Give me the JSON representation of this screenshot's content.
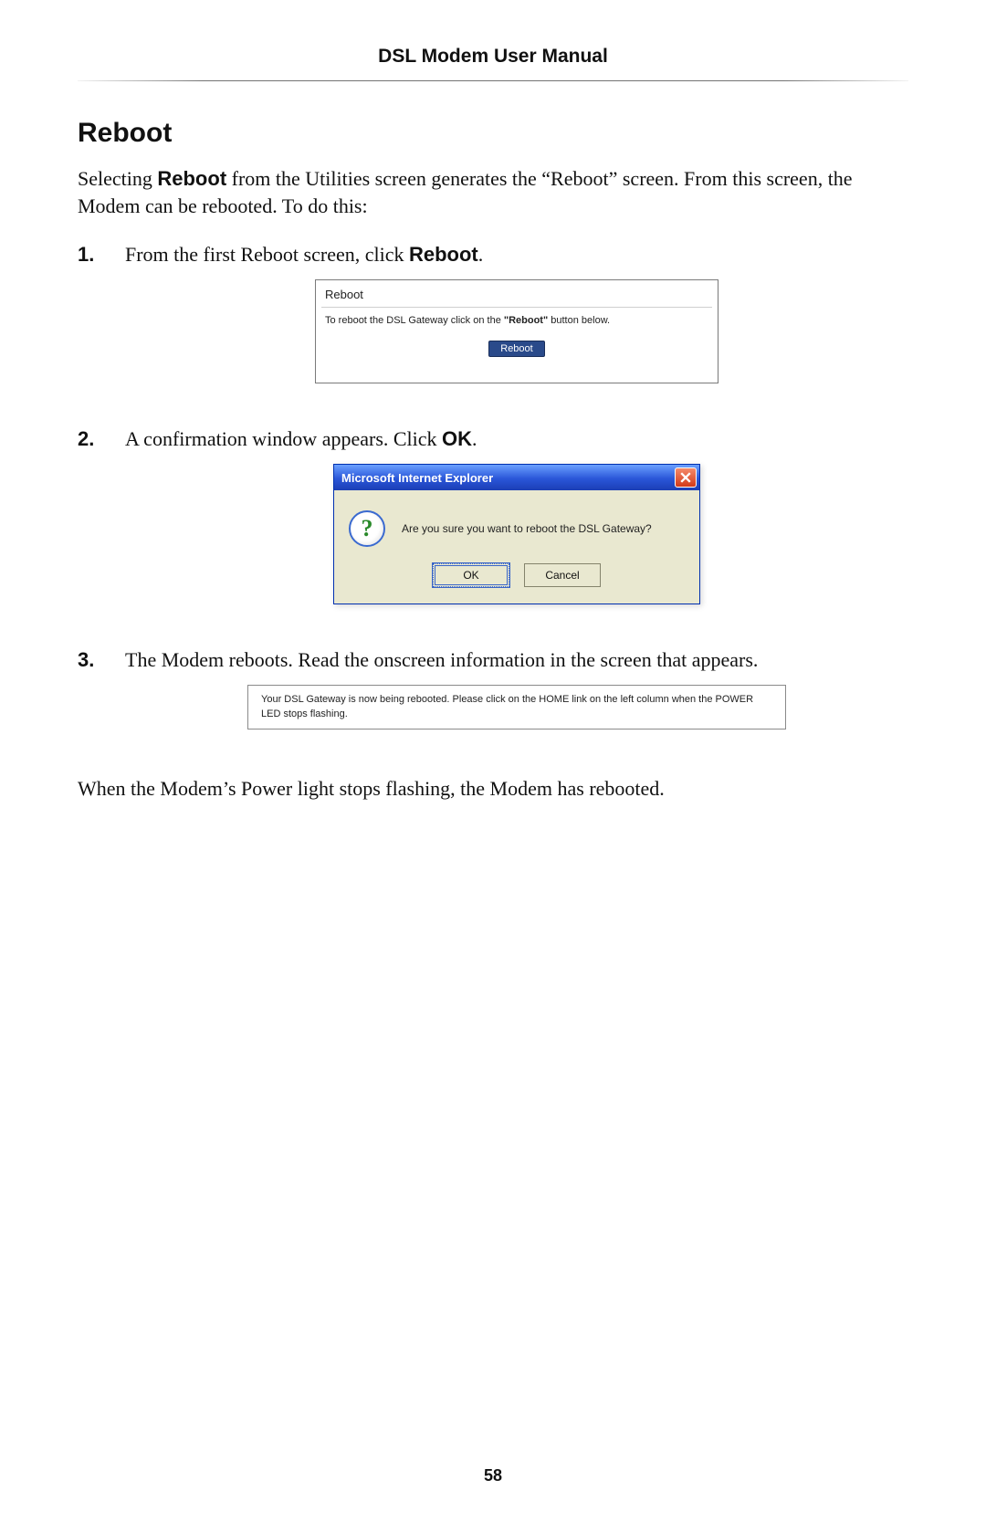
{
  "header": {
    "title": "DSL Modem User Manual"
  },
  "section": {
    "heading": "Reboot",
    "intro_pre": "Selecting ",
    "intro_bold1": "Reboot",
    "intro_post": " from the Utilities screen generates the “Reboot” screen. From this screen, the Modem can be rebooted. To do this:"
  },
  "steps": [
    {
      "num": "1.",
      "pre": "From the first Reboot screen, click ",
      "bold": "Reboot",
      "post": "."
    },
    {
      "num": "2.",
      "pre": "A confirmation window appears. Click ",
      "bold": "OK",
      "post": "."
    },
    {
      "num": "3.",
      "text": "The Modem reboots. Read the onscreen information in the screen that appears."
    }
  ],
  "figure1": {
    "title": "Reboot",
    "instr_pre": "To reboot the DSL Gateway click on the ",
    "instr_bold": "\"Reboot\"",
    "instr_post": " button below.",
    "button": "Reboot"
  },
  "figure2": {
    "title": "Microsoft Internet Explorer",
    "message": "Are you sure you want to reboot the DSL Gateway?",
    "ok": "OK",
    "cancel": "Cancel"
  },
  "figure3": {
    "text": "Your DSL Gateway is now being rebooted. Please click on the HOME link on the left column when the POWER LED stops flashing."
  },
  "closing": "When the Modem’s Power light stops flashing, the Modem has rebooted.",
  "page_number": "58"
}
